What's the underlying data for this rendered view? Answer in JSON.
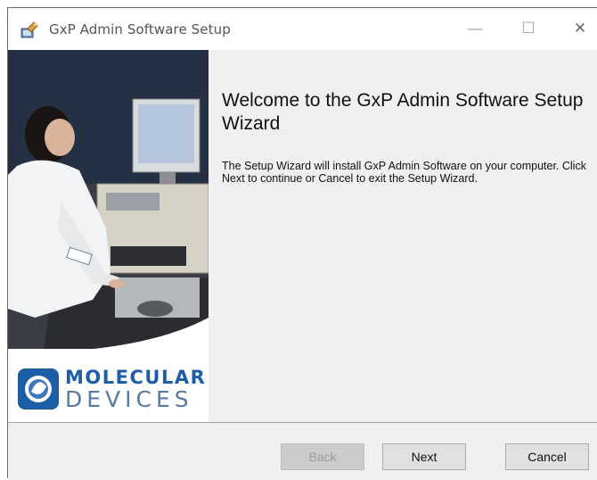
{
  "window": {
    "title": "GxP Admin Software Setup",
    "controls": {
      "minimize": "—",
      "maximize": "☐",
      "close": "✕"
    }
  },
  "content": {
    "heading": "Welcome to the GxP Admin Software Setup Wizard",
    "body": "The Setup Wizard will install GxP Admin Software on your computer. Click Next to continue or Cancel to exit the Setup Wizard."
  },
  "brand": {
    "line1": "MOLECULAR",
    "line2": "DEVICES"
  },
  "buttons": {
    "back": "Back",
    "next": "Next",
    "cancel": "Cancel"
  }
}
